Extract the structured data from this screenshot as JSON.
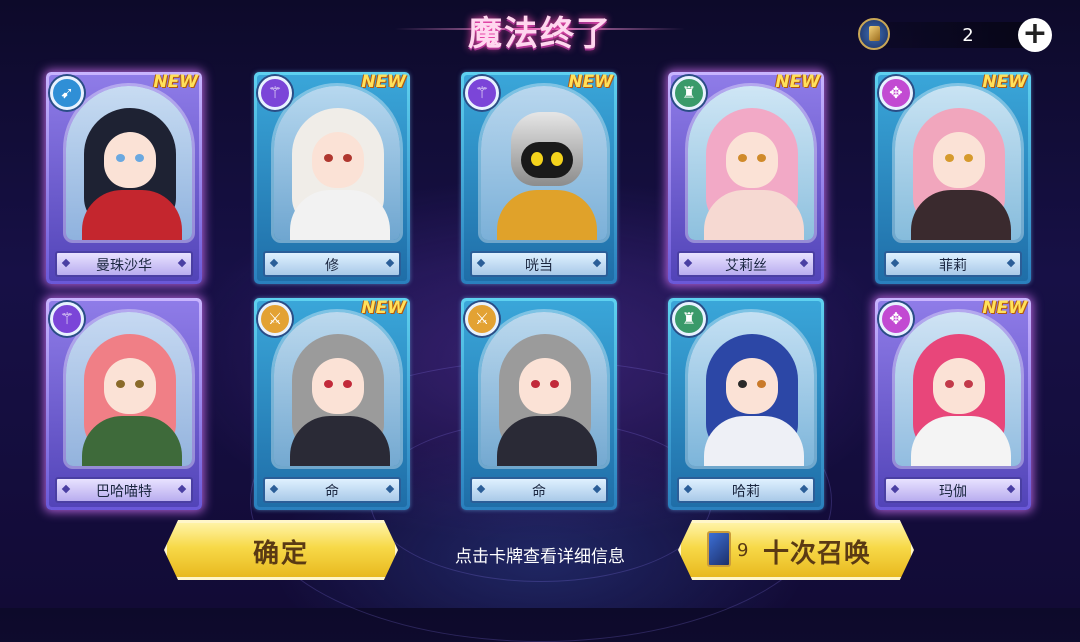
{
  "header": {
    "title": "魔法终了",
    "currency_icon": "summon-ticket-icon",
    "currency_count": "2",
    "plus_label": "+"
  },
  "cards": [
    {
      "name": "曼珠沙华",
      "new": "NEW",
      "class_icon": "bow-class-icon",
      "frame": "purple"
    },
    {
      "name": "修",
      "new": "NEW",
      "class_icon": "staff-class-icon",
      "frame": "blue"
    },
    {
      "name": "咣当",
      "new": "NEW",
      "class_icon": "staff-class-icon",
      "frame": "blue"
    },
    {
      "name": "艾莉丝",
      "new": "NEW",
      "class_icon": "tower-class-icon",
      "frame": "purple"
    },
    {
      "name": "菲莉",
      "new": "NEW",
      "class_icon": "orb-class-icon",
      "frame": "blue"
    },
    {
      "name": "巴哈喵特",
      "new": "",
      "class_icon": "staff-class-icon",
      "frame": "purple"
    },
    {
      "name": "命",
      "new": "NEW",
      "class_icon": "swords-class-icon",
      "frame": "blue"
    },
    {
      "name": "命",
      "new": "",
      "class_icon": "swords-class-icon",
      "frame": "blue"
    },
    {
      "name": "哈莉",
      "new": "",
      "class_icon": "tower-class-icon",
      "frame": "blue"
    },
    {
      "name": "玛伽",
      "new": "NEW",
      "class_icon": "orb-class-icon",
      "frame": "purple"
    }
  ],
  "footer": {
    "confirm_label": "确定",
    "hint": "点击卡牌查看详细信息",
    "summon_cost": "9",
    "summon_label": "十次召唤"
  }
}
